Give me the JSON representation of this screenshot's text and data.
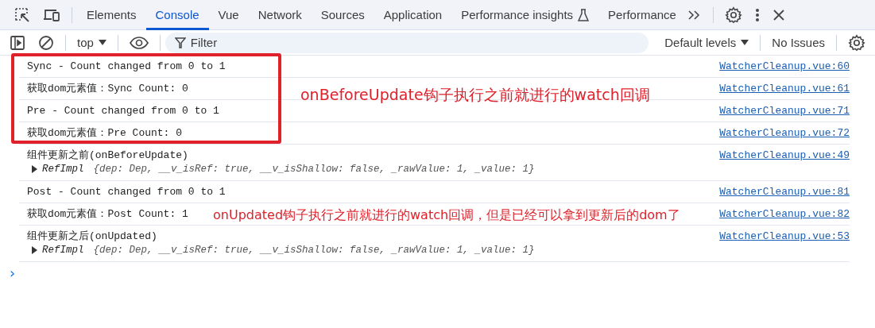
{
  "tabs": [
    {
      "label": "Elements",
      "selected": false
    },
    {
      "label": "Console",
      "selected": true
    },
    {
      "label": "Vue",
      "selected": false
    },
    {
      "label": "Network",
      "selected": false
    },
    {
      "label": "Sources",
      "selected": false
    },
    {
      "label": "Application",
      "selected": false
    },
    {
      "label": "Performance insights",
      "selected": false,
      "experimental": true
    },
    {
      "label": "Performance",
      "selected": false
    }
  ],
  "console_toolbar": {
    "context": "top",
    "filter": {
      "placeholder": "Filter"
    },
    "levels": "Default levels",
    "issues": "No Issues"
  },
  "messages": [
    {
      "text": "Sync - Count changed from 0 to 1",
      "source": "WatcherCleanup.vue:60"
    },
    {
      "text": "获取dom元素值：Sync Count: 0",
      "source": "WatcherCleanup.vue:61"
    },
    {
      "text": "Pre - Count changed from 0 to 1",
      "source": "WatcherCleanup.vue:71"
    },
    {
      "text": "获取dom元素值：Pre Count: 0",
      "source": "WatcherCleanup.vue:72"
    },
    {
      "text": "组件更新之前(onBeforeUpdate)",
      "source": "WatcherCleanup.vue:49",
      "object": {
        "expanded": false,
        "class_name": "RefImpl",
        "preview": "{dep: Dep, __v_isRef: true, __v_isShallow: false, _rawValue: 1, _value: 1}"
      }
    },
    {
      "text": "Post - Count changed from 0 to 1",
      "source": "WatcherCleanup.vue:81"
    },
    {
      "text": "获取dom元素值：Post Count: 1",
      "source": "WatcherCleanup.vue:82"
    },
    {
      "text": "组件更新之后(onUpdated)",
      "source": "WatcherCleanup.vue:53",
      "object": {
        "expanded": false,
        "class_name": "RefImpl",
        "preview": "{dep: Dep, __v_isRef: true, __v_isShallow: false, _rawValue: 1, _value: 1}"
      }
    }
  ],
  "prompt": "›",
  "annotations": [
    {
      "text": "onBeforeUpdate钩子执行之前就进行的watch回调"
    },
    {
      "text": "onUpdated钩子执行之前就进行的watch回调，但是已经可以拿到更新后的dom了"
    }
  ]
}
